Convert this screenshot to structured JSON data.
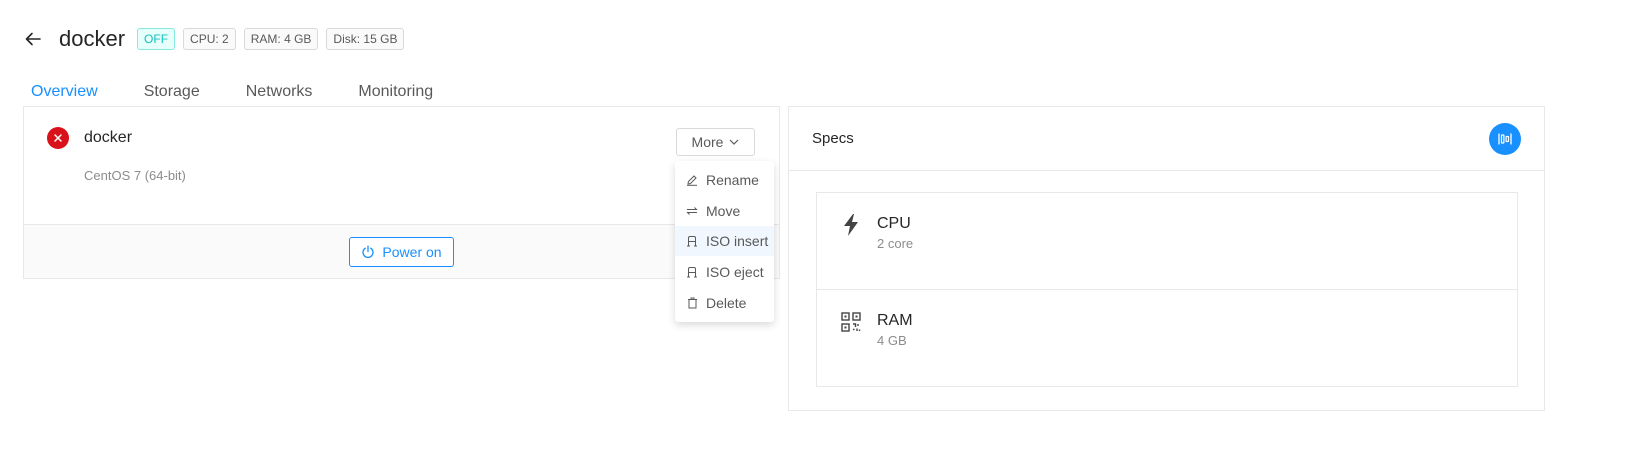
{
  "header": {
    "title": "docker",
    "status_tag": "OFF",
    "tags": [
      "CPU: 2",
      "RAM: 4 GB",
      "Disk: 15 GB"
    ]
  },
  "tabs": [
    {
      "label": "Overview",
      "active": true
    },
    {
      "label": "Storage",
      "active": false
    },
    {
      "label": "Networks",
      "active": false
    },
    {
      "label": "Monitoring",
      "active": false
    }
  ],
  "vm": {
    "name": "docker",
    "os": "CentOS 7 (64-bit)",
    "status_icon": "close-circle-icon",
    "status_color": "#d9111a"
  },
  "actions": {
    "more_label": "More",
    "power_label": "Power on"
  },
  "menu": {
    "items": [
      {
        "label": "Rename",
        "icon": "edit-icon"
      },
      {
        "label": "Move",
        "icon": "move-icon"
      },
      {
        "label": "ISO insert",
        "icon": "iso-insert-icon"
      },
      {
        "label": "ISO eject",
        "icon": "iso-eject-icon"
      },
      {
        "label": "Delete",
        "icon": "delete-icon"
      }
    ],
    "hovered_index": 2
  },
  "specs": {
    "title": "Specs",
    "items": [
      {
        "label": "CPU",
        "value": "2 core",
        "icon": "lightning-icon"
      },
      {
        "label": "RAM",
        "value": "4 GB",
        "icon": "qrcode-icon"
      }
    ]
  },
  "colors": {
    "accent": "#1890ff",
    "status_off_border": "#87e8de",
    "status_off_bg": "#e6fffb",
    "status_off_text": "#13c2c2",
    "danger": "#d9111a"
  }
}
